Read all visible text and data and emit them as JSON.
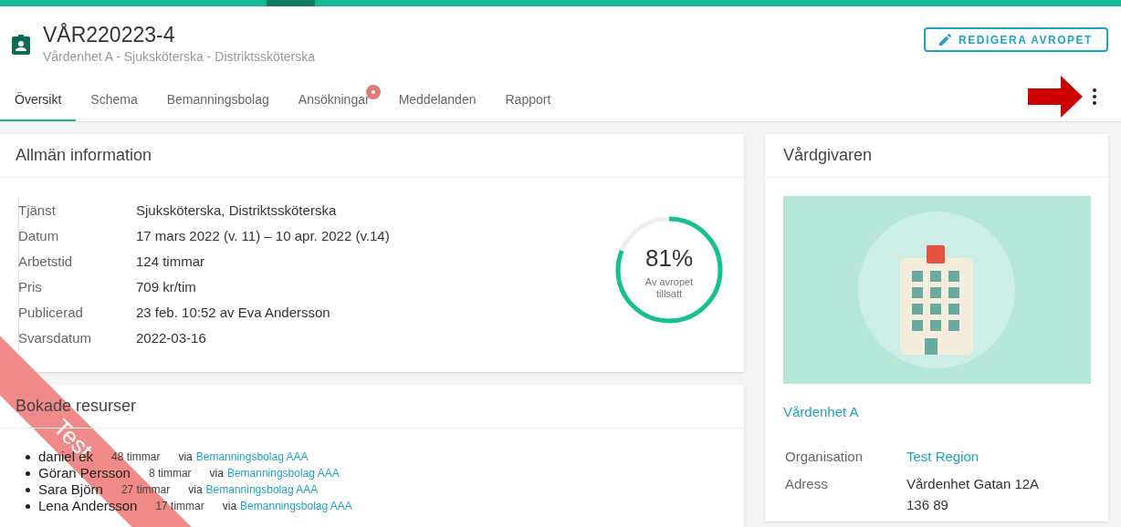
{
  "header": {
    "title": "VÅR220223-4",
    "subtitle": "Vårdenhet A - Sjuksköterska - Distriktssköterska",
    "edit_button": "REDIGERA AVROPET"
  },
  "tabs": [
    {
      "label": "Översikt",
      "selected": true,
      "badge": false
    },
    {
      "label": "Schema",
      "selected": false,
      "badge": false
    },
    {
      "label": "Bemanningsbolag",
      "selected": false,
      "badge": false
    },
    {
      "label": "Ansökningar",
      "selected": false,
      "badge": true
    },
    {
      "label": "Meddelanden",
      "selected": false,
      "badge": false
    },
    {
      "label": "Rapport",
      "selected": false,
      "badge": false
    }
  ],
  "general_info": {
    "title": "Allmän information",
    "rows": [
      {
        "label": "Tjänst",
        "value": "Sjuksköterska, Distriktssköterska"
      },
      {
        "label": "Datum",
        "value": "17 mars 2022 (v. 11) – 10 apr. 2022 (v.14)"
      },
      {
        "label": "Arbetstid",
        "value": "124 timmar"
      },
      {
        "label": "Pris",
        "value": "709 kr/tim"
      },
      {
        "label": "Publicerad",
        "value": "23 feb. 10:52 av Eva Andersson"
      },
      {
        "label": "Svarsdatum",
        "value": "2022-03-16"
      }
    ],
    "progress": {
      "level": 0.81,
      "percent": "81%",
      "caption": "Av avropet tillsatt"
    }
  },
  "booked_resources": {
    "title": "Bokade resurser",
    "items": [
      {
        "name": "daniel ek",
        "hours": "48 timmar",
        "via": "via",
        "agency": "Bemanningsbolag AAA"
      },
      {
        "name": "Göran Persson",
        "hours": "8 timmar",
        "via": "via",
        "agency": "Bemanningsbolag AAA"
      },
      {
        "name": "Sara Björn",
        "hours": "27 timmar",
        "via": "via",
        "agency": "Bemanningsbolag AAA"
      },
      {
        "name": "Lena Andersson",
        "hours": "17 timmar",
        "via": "via",
        "agency": "Bemanningsbolag AAA"
      }
    ]
  },
  "care_provider": {
    "title": "Vårdgivaren",
    "unit_link": "Vårdenhet A",
    "rows": [
      {
        "label": "Organisation",
        "value": "Test Region",
        "link": true
      },
      {
        "label": "Adress",
        "value": "Vårdenhet Gatan 12A\n136 89",
        "link": false
      }
    ]
  },
  "ribbon": "Test"
}
